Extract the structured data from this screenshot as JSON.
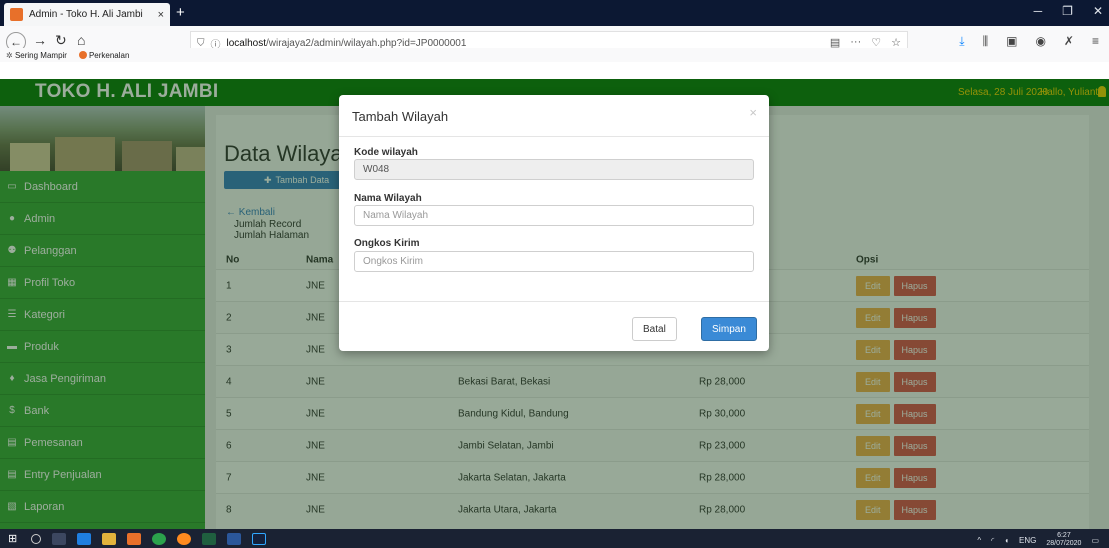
{
  "browser": {
    "tab_title": "Admin - Toko H. Ali Jambi",
    "tab_close": "×",
    "new_tab": "+",
    "url_host": "localhost",
    "url_path": "/wirajaya2/admin/wilayah.php?id=JP0000001",
    "bookmarks": [
      "Sering Mampir",
      "Perkenalan"
    ]
  },
  "app": {
    "brand": "TOKO H. ALI JAMBI",
    "header_date": "Selasa, 28 Juli 2020",
    "header_greeting": "Hallo, Yulianto"
  },
  "sidebar": {
    "items": [
      {
        "label": "Dashboard",
        "icon": "monitor-icon"
      },
      {
        "label": "Admin",
        "icon": "user-icon"
      },
      {
        "label": "Pelanggan",
        "icon": "users-icon"
      },
      {
        "label": "Profil Toko",
        "icon": "table-icon"
      },
      {
        "label": "Kategori",
        "icon": "list-icon"
      },
      {
        "label": "Produk",
        "icon": "drawer-icon"
      },
      {
        "label": "Jasa Pengiriman",
        "icon": "map-marker-icon"
      },
      {
        "label": "Bank",
        "icon": "dollar-icon"
      },
      {
        "label": "Pemesanan",
        "icon": "credit-card-icon"
      },
      {
        "label": "Entry Penjualan",
        "icon": "credit-card-icon"
      },
      {
        "label": "Laporan",
        "icon": "report-icon"
      }
    ]
  },
  "main": {
    "page_title": "Data Wilayah",
    "add_button": "Tambah Data",
    "back_link": "Kembali",
    "record_label": "Jumlah Record",
    "pages_label": "Jumlah Halaman",
    "columns": {
      "no": "No",
      "name": "Nama",
      "opt": "Opsi"
    },
    "rows": [
      {
        "no": "1",
        "name": "JNE",
        "area": "",
        "price": ""
      },
      {
        "no": "2",
        "name": "JNE",
        "area": "",
        "price": ""
      },
      {
        "no": "3",
        "name": "JNE",
        "area": "",
        "price": ""
      },
      {
        "no": "4",
        "name": "JNE",
        "area": "Bekasi Barat, Bekasi",
        "price": "Rp 28,000"
      },
      {
        "no": "5",
        "name": "JNE",
        "area": "Bandung Kidul, Bandung",
        "price": "Rp 30,000"
      },
      {
        "no": "6",
        "name": "JNE",
        "area": "Jambi Selatan, Jambi",
        "price": "Rp 23,000"
      },
      {
        "no": "7",
        "name": "JNE",
        "area": "Jakarta Selatan, Jakarta",
        "price": "Rp 28,000"
      },
      {
        "no": "8",
        "name": "JNE",
        "area": "Jakarta Utara, Jakarta",
        "price": "Rp 28,000"
      }
    ],
    "edit_label": "Edit",
    "delete_label": "Hapus"
  },
  "modal": {
    "title": "Tambah Wilayah",
    "close": "×",
    "kode_label": "Kode wilayah",
    "kode_value": "W048",
    "nama_label": "Nama Wilayah",
    "nama_placeholder": "Nama Wilayah",
    "ongkos_label": "Ongkos Kirim",
    "ongkos_placeholder": "Ongkos Kirim",
    "cancel_label": "Batal",
    "save_label": "Simpan"
  },
  "taskbar": {
    "lang": "ENG",
    "time": "6:27",
    "date": "28/07/2020"
  },
  "colors": {
    "header_green": "#0a7a0a",
    "sidebar_green": "#3aa63a",
    "primary_blue": "#3a8ad6",
    "edit_orange": "#f0ad4e",
    "delete_red": "#d9534f",
    "header_text_yellow": "#f0d000"
  }
}
